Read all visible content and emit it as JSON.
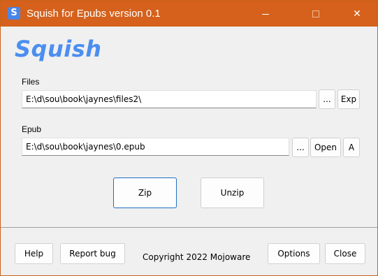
{
  "window": {
    "title": "Squish for Epubs version 0.1",
    "icon_letter": "S"
  },
  "logo": {
    "text": "Squish"
  },
  "files": {
    "label": "Files",
    "value": "E:\\d\\sou\\book\\jaynes\\files2\\",
    "browse_label": "...",
    "explore_label": "Exp"
  },
  "epub": {
    "label": "Epub",
    "value": "E:\\d\\sou\\book\\jaynes\\0.epub",
    "browse_label": "...",
    "open_label": "Open",
    "a_label": "A"
  },
  "actions": {
    "zip_label": "Zip",
    "unzip_label": "Unzip"
  },
  "footer": {
    "help_label": "Help",
    "report_label": "Report bug",
    "copyright": "Copyright 2022 Mojoware",
    "options_label": "Options",
    "close_label": "Close"
  },
  "colors": {
    "titlebar": "#d5611c",
    "logo": "#4b8ef0",
    "window_bg": "#f0f0f0"
  },
  "icons": {
    "app": "squish-app-icon",
    "minimize": "minimize-icon",
    "maximize": "maximize-icon",
    "close": "close-icon"
  }
}
